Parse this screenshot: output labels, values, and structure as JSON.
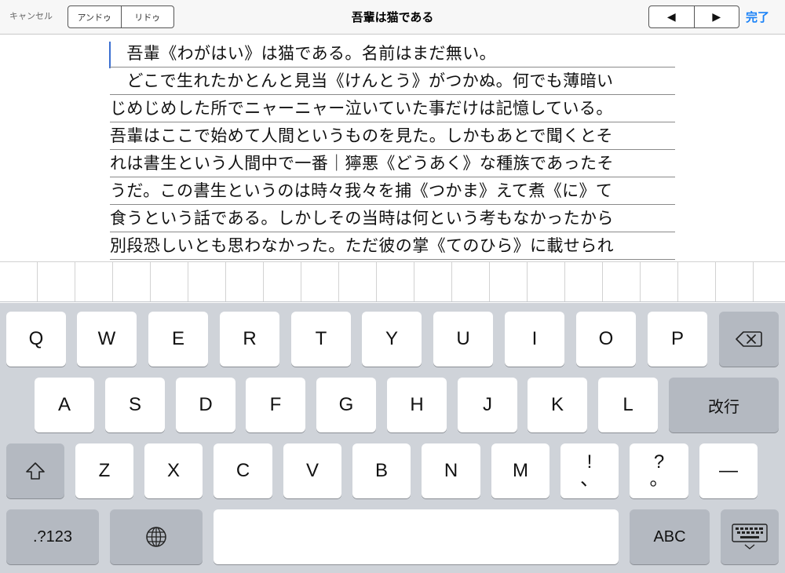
{
  "toolbar": {
    "cancel_label": "キャンセル",
    "undo_label": "アンドゥ",
    "redo_label": "リドゥ",
    "title": "吾輩は猫である",
    "prev_label": "◀",
    "next_label": "▶",
    "done_label": "完了",
    "accent_color": "#1a82f7"
  },
  "editor": {
    "lines": [
      "　吾輩《わがはい》は猫である。名前はまだ無い。",
      "　どこで生れたかとんと見当《けんとう》がつかぬ。何でも薄暗い",
      "じめじめした所でニャーニャー泣いていた事だけは記憶している。",
      "吾輩はここで始めて人間というものを見た。しかもあとで聞くとそ",
      "れは書生という人間中で一番｜獰悪《どうあく》な種族であったそ",
      "うだ。この書生というのは時々我々を捕《つかま》えて煮《に》て",
      "食うという話である。しかしその当時は何という考もなかったから",
      "別段恐しいとも思わなかった。ただ彼の掌《てのひら》に載せられ"
    ]
  },
  "keyboard": {
    "row1": [
      "Q",
      "W",
      "E",
      "R",
      "T",
      "Y",
      "U",
      "I",
      "O",
      "P"
    ],
    "row2": [
      "A",
      "S",
      "D",
      "F",
      "G",
      "H",
      "J",
      "K",
      "L"
    ],
    "return_label": "改行",
    "row3": [
      "Z",
      "X",
      "C",
      "V",
      "B",
      "N",
      "M"
    ],
    "exclaim_top": "!",
    "exclaim_bottom": "、",
    "question_top": "?",
    "question_bottom": "。",
    "dash_label": "—",
    "numbers_label": ".?123",
    "abc_label": "ABC",
    "icons": {
      "backspace": "backspace-icon",
      "shift": "shift-icon",
      "globe": "globe-icon",
      "hide_keyboard": "keyboard-hide-icon"
    }
  }
}
